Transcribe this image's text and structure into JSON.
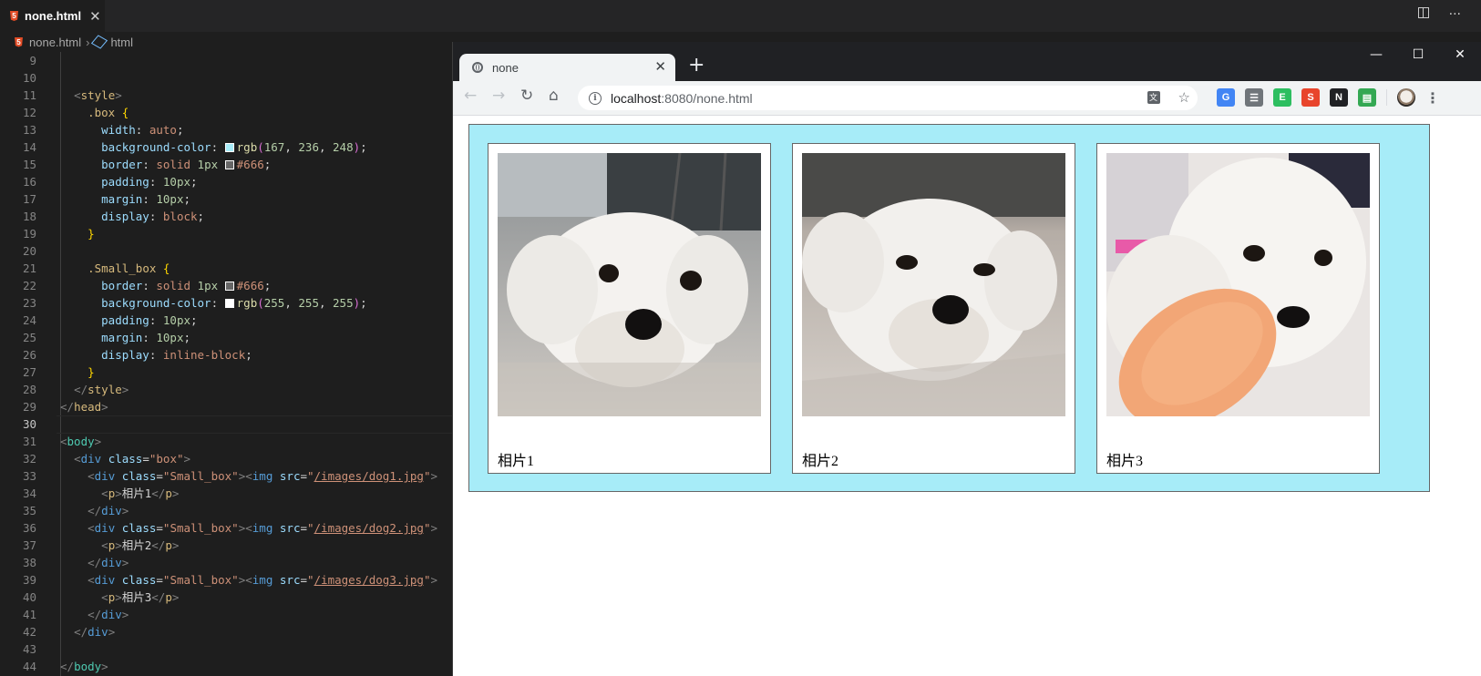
{
  "editor": {
    "tab_title": "none.html",
    "breadcrumb": [
      "none.html",
      "html"
    ],
    "lines": [
      {
        "n": "9",
        "html": ""
      },
      {
        "n": "10",
        "html": ""
      },
      {
        "n": "11",
        "html": "  <span class=\"tg\">&lt;</span><span class=\"tn-style\">style</span><span class=\"tg\">&gt;</span>"
      },
      {
        "n": "12",
        "html": "    <span class=\"sel\">.box</span> <span class=\"br\">{</span>"
      },
      {
        "n": "13",
        "html": "      <span class=\"pr\">width</span>: <span class=\"vl\">auto</span>;"
      },
      {
        "n": "14",
        "html": "      <span class=\"pr\">background-color</span>: <span class=\"swatch\" style=\"background:rgb(167,236,248)\"></span><span class=\"fn\">rgb</span><span class=\"br2\">(</span><span class=\"nm\">167</span>, <span class=\"nm\">236</span>, <span class=\"nm\">248</span><span class=\"br2\">)</span>;"
      },
      {
        "n": "15",
        "html": "      <span class=\"pr\">border</span>: <span class=\"vl\">solid</span> <span class=\"nm\">1px</span> <span class=\"swatch\" style=\"background:#666\"></span><span class=\"vl\">#666</span>;"
      },
      {
        "n": "16",
        "html": "      <span class=\"pr\">padding</span>: <span class=\"nm\">10px</span>;"
      },
      {
        "n": "17",
        "html": "      <span class=\"pr\">margin</span>: <span class=\"nm\">10px</span>;"
      },
      {
        "n": "18",
        "html": "      <span class=\"pr\">display</span>: <span class=\"vl\">block</span>;"
      },
      {
        "n": "19",
        "html": "    <span class=\"br\">}</span>"
      },
      {
        "n": "20",
        "html": ""
      },
      {
        "n": "21",
        "html": "    <span class=\"sel\">.Small_box</span> <span class=\"br\">{</span>"
      },
      {
        "n": "22",
        "html": "      <span class=\"pr\">border</span>: <span class=\"vl\">solid</span> <span class=\"nm\">1px</span> <span class=\"swatch\" style=\"background:#666\"></span><span class=\"vl\">#666</span>;"
      },
      {
        "n": "23",
        "html": "      <span class=\"pr\">background-color</span>: <span class=\"swatch\" style=\"background:#fff\"></span><span class=\"fn\">rgb</span><span class=\"br2\">(</span><span class=\"nm\">255</span>, <span class=\"nm\">255</span>, <span class=\"nm\">255</span><span class=\"br2\">)</span>;"
      },
      {
        "n": "24",
        "html": "      <span class=\"pr\">padding</span>: <span class=\"nm\">10px</span>;"
      },
      {
        "n": "25",
        "html": "      <span class=\"pr\">margin</span>: <span class=\"nm\">10px</span>;"
      },
      {
        "n": "26",
        "html": "      <span class=\"pr\">display</span>: <span class=\"vl\">inline-block</span>;"
      },
      {
        "n": "27",
        "html": "    <span class=\"br\">}</span>"
      },
      {
        "n": "28",
        "html": "  <span class=\"tg\">&lt;/</span><span class=\"tn-style\">style</span><span class=\"tg\">&gt;</span>"
      },
      {
        "n": "29",
        "html": "<span class=\"tg\">&lt;/</span><span class=\"tn-style\">head</span><span class=\"tg\">&gt;</span>"
      },
      {
        "n": "30",
        "html": "",
        "active": true
      },
      {
        "n": "31",
        "html": "<span class=\"tg\">&lt;</span><span class=\"tn-body\">body</span><span class=\"tg\">&gt;</span>"
      },
      {
        "n": "32",
        "html": "  <span class=\"tg\">&lt;</span><span class=\"tn\">div</span> <span class=\"an\">class</span>=<span class=\"av\">\"box\"</span><span class=\"tg\">&gt;</span>"
      },
      {
        "n": "33",
        "html": "    <span class=\"tg\">&lt;</span><span class=\"tn\">div</span> <span class=\"an\">class</span>=<span class=\"av\">\"Small_box\"</span><span class=\"tg\">&gt;&lt;</span><span class=\"tn\">img</span> <span class=\"an\">src</span>=<span class=\"av\">\"</span><span class=\"link\">/images/dog1.jpg</span><span class=\"av\">\"</span><span class=\"tg\">&gt;</span>"
      },
      {
        "n": "34",
        "html": "      <span class=\"tg\">&lt;</span><span class=\"tn-style\">p</span><span class=\"tg\">&gt;</span>相片1<span class=\"tg\">&lt;/</span><span class=\"tn-style\">p</span><span class=\"tg\">&gt;</span>"
      },
      {
        "n": "35",
        "html": "    <span class=\"tg\">&lt;/</span><span class=\"tn\">div</span><span class=\"tg\">&gt;</span>"
      },
      {
        "n": "36",
        "html": "    <span class=\"tg\">&lt;</span><span class=\"tn\">div</span> <span class=\"an\">class</span>=<span class=\"av\">\"Small_box\"</span><span class=\"tg\">&gt;&lt;</span><span class=\"tn\">img</span> <span class=\"an\">src</span>=<span class=\"av\">\"</span><span class=\"link\">/images/dog2.jpg</span><span class=\"av\">\"</span><span class=\"tg\">&gt;</span>"
      },
      {
        "n": "37",
        "html": "      <span class=\"tg\">&lt;</span><span class=\"tn-style\">p</span><span class=\"tg\">&gt;</span>相片2<span class=\"tg\">&lt;/</span><span class=\"tn-style\">p</span><span class=\"tg\">&gt;</span>"
      },
      {
        "n": "38",
        "html": "    <span class=\"tg\">&lt;/</span><span class=\"tn\">div</span><span class=\"tg\">&gt;</span>"
      },
      {
        "n": "39",
        "html": "    <span class=\"tg\">&lt;</span><span class=\"tn\">div</span> <span class=\"an\">class</span>=<span class=\"av\">\"Small_box\"</span><span class=\"tg\">&gt;&lt;</span><span class=\"tn\">img</span> <span class=\"an\">src</span>=<span class=\"av\">\"</span><span class=\"link\">/images/dog3.jpg</span><span class=\"av\">\"</span><span class=\"tg\">&gt;</span>"
      },
      {
        "n": "40",
        "html": "      <span class=\"tg\">&lt;</span><span class=\"tn-style\">p</span><span class=\"tg\">&gt;</span>相片3<span class=\"tg\">&lt;/</span><span class=\"tn-style\">p</span><span class=\"tg\">&gt;</span>"
      },
      {
        "n": "41",
        "html": "    <span class=\"tg\">&lt;/</span><span class=\"tn\">div</span><span class=\"tg\">&gt;</span>"
      },
      {
        "n": "42",
        "html": "  <span class=\"tg\">&lt;/</span><span class=\"tn\">div</span><span class=\"tg\">&gt;</span>"
      },
      {
        "n": "43",
        "html": ""
      },
      {
        "n": "44",
        "html": "<span class=\"tg\">&lt;/</span><span class=\"tn-body\">body</span><span class=\"tg\">&gt;</span>"
      }
    ]
  },
  "browser": {
    "tab_title": "none",
    "url_host": "localhost",
    "url_rest": ":8080/none.html",
    "extensions": [
      {
        "name": "translate-extension-icon",
        "color": "#4285f4",
        "glyph": "G"
      },
      {
        "name": "archive-extension-icon",
        "color": "#70757a",
        "glyph": "☰"
      },
      {
        "name": "evernote-extension-icon",
        "color": "#2dbe60",
        "glyph": "E"
      },
      {
        "name": "s-extension-icon",
        "color": "#e8452c",
        "glyph": "S"
      },
      {
        "name": "notion-extension-icon",
        "color": "#202124",
        "glyph": "N"
      },
      {
        "name": "clipboard-extension-icon",
        "color": "#34a853",
        "glyph": "▤"
      }
    ]
  },
  "page": {
    "box_color": "rgb(167, 236, 248)",
    "photos": [
      {
        "caption": "相片1"
      },
      {
        "caption": "相片2"
      },
      {
        "caption": "相片3"
      }
    ]
  }
}
